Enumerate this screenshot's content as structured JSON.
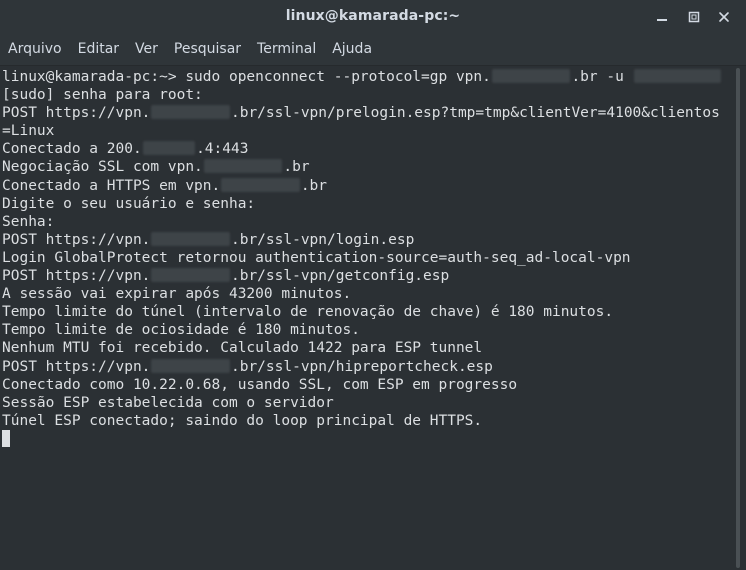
{
  "window": {
    "title": "linux@kamarada-pc:~"
  },
  "menu": {
    "items": [
      "Arquivo",
      "Editar",
      "Ver",
      "Pesquisar",
      "Terminal",
      "Ajuda"
    ]
  },
  "terminal": {
    "lines": [
      {
        "segments": [
          {
            "t": "linux@kamarada-pc:~> sudo openconnect --protocol=gp vpn."
          },
          {
            "r": "xxxxxxxxx"
          },
          {
            "t": ".br -u "
          },
          {
            "r": "xxxxxxxxxx"
          }
        ]
      },
      {
        "segments": [
          {
            "t": "[sudo] senha para root:"
          }
        ]
      },
      {
        "segments": [
          {
            "t": "POST https://vpn."
          },
          {
            "r": "xxxxxxxxx"
          },
          {
            "t": ".br/ssl-vpn/prelogin.esp?tmp=tmp&clientVer=4100&clientos"
          }
        ]
      },
      {
        "segments": [
          {
            "t": "=Linux"
          }
        ]
      },
      {
        "segments": [
          {
            "t": "Conectado a 200."
          },
          {
            "r": "xxxxxx"
          },
          {
            "t": ".4:443"
          }
        ]
      },
      {
        "segments": [
          {
            "t": "Negociação SSL com vpn."
          },
          {
            "r": "xxxxxxxxx"
          },
          {
            "t": ".br"
          }
        ]
      },
      {
        "segments": [
          {
            "t": "Conectado a HTTPS em vpn."
          },
          {
            "r": "xxxxxxxxx"
          },
          {
            "t": ".br"
          }
        ]
      },
      {
        "segments": [
          {
            "t": "Digite o seu usuário e senha:"
          }
        ]
      },
      {
        "segments": [
          {
            "t": "Senha:"
          }
        ]
      },
      {
        "segments": [
          {
            "t": "POST https://vpn."
          },
          {
            "r": "xxxxxxxxx"
          },
          {
            "t": ".br/ssl-vpn/login.esp"
          }
        ]
      },
      {
        "segments": [
          {
            "t": "Login GlobalProtect retornou authentication-source=auth-seq_ad-local-vpn"
          }
        ]
      },
      {
        "segments": [
          {
            "t": "POST https://vpn."
          },
          {
            "r": "xxxxxxxxx"
          },
          {
            "t": ".br/ssl-vpn/getconfig.esp"
          }
        ]
      },
      {
        "segments": [
          {
            "t": "A sessão vai expirar após 43200 minutos."
          }
        ]
      },
      {
        "segments": [
          {
            "t": "Tempo limite do túnel (intervalo de renovação de chave) é 180 minutos."
          }
        ]
      },
      {
        "segments": [
          {
            "t": "Tempo limite de ociosidade é 180 minutos."
          }
        ]
      },
      {
        "segments": [
          {
            "t": "Nenhum MTU foi recebido. Calculado 1422 para ESP tunnel"
          }
        ]
      },
      {
        "segments": [
          {
            "t": "POST https://vpn."
          },
          {
            "r": "xxxxxxxxx"
          },
          {
            "t": ".br/ssl-vpn/hipreportcheck.esp"
          }
        ]
      },
      {
        "segments": [
          {
            "t": "Conectado como 10.22.0.68, usando SSL, com ESP em progresso"
          }
        ]
      },
      {
        "segments": [
          {
            "t": "Sessão ESP estabelecida com o servidor"
          }
        ]
      },
      {
        "segments": [
          {
            "t": "Túnel ESP conectado; saindo do loop principal de HTTPS."
          }
        ]
      }
    ]
  },
  "icons": {
    "minimize": "minimize-icon",
    "maximize": "maximize-icon",
    "close": "close-icon"
  },
  "colors": {
    "background": "#2b3034",
    "text": "#dcdfe2",
    "titlebar": "#2f3539"
  }
}
